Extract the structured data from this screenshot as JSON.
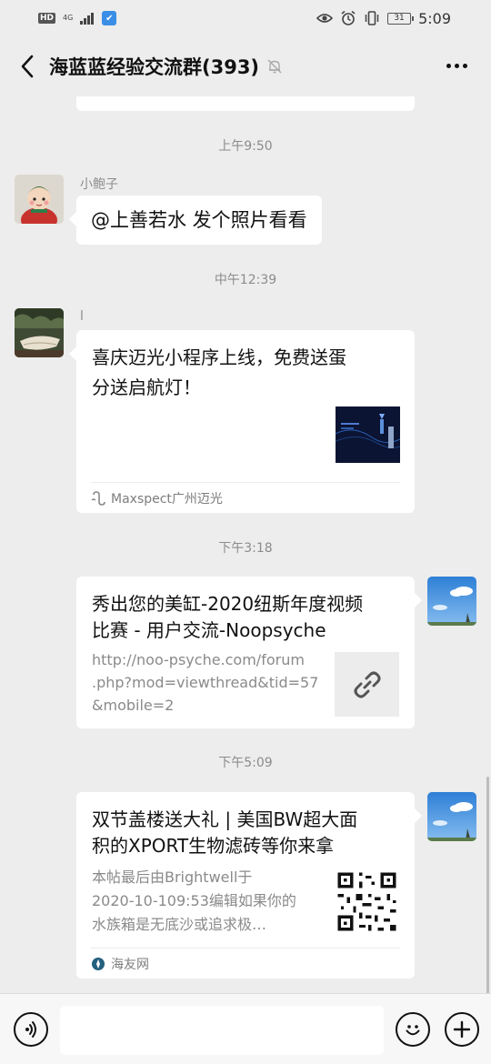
{
  "status_bar": {
    "hd": "HD",
    "network": "4G",
    "battery": "31",
    "time": "5:09"
  },
  "header": {
    "title": "海蓝蓝经验交流群(393)"
  },
  "messages": [
    {
      "type": "timestamp",
      "text": "上午9:50"
    },
    {
      "type": "text",
      "direction": "in",
      "sender": "小鲍子",
      "text": "@上善若水  发个照片看看"
    },
    {
      "type": "timestamp",
      "text": "中午12:39"
    },
    {
      "type": "card",
      "direction": "in",
      "sender": "l",
      "title_lines": [
        "喜庆迈光小程序上线，免费送蛋",
        "分送启航灯！"
      ],
      "source": "Maxspect广州迈光"
    },
    {
      "type": "timestamp",
      "text": "下午3:18"
    },
    {
      "type": "link",
      "direction": "out",
      "title_lines": [
        "秀出您的美缸-2020纽斯年度视频",
        "比赛 - 用户交流-Noopsyche"
      ],
      "desc_lines": [
        "http://noo-psyche.com/forum",
        ".php?mod=viewthread&tid=57",
        "&mobile=2"
      ]
    },
    {
      "type": "timestamp",
      "text": "下午5:09"
    },
    {
      "type": "card",
      "direction": "out",
      "title_lines": [
        "双节盖楼送大礼 | 美国BW超大面",
        "积的XPORT生物滤砖等你来拿"
      ],
      "desc_lines": [
        "本帖最后由Brightwell于",
        "2020-10-109:53编辑如果你的",
        "水族箱是无底沙或追求极…"
      ],
      "source": "海友网"
    }
  ],
  "input": {
    "placeholder": ""
  },
  "icons": {
    "back": "chevron-left-icon",
    "mute": "bell-off-icon",
    "more": "more-dots-icon",
    "voice": "voice-icon",
    "emoji": "emoji-icon",
    "plus": "plus-icon",
    "link": "link-icon"
  },
  "colors": {
    "background": "#ededed",
    "bubble": "#ffffff",
    "meta_text": "#8c8c8c",
    "input_bar": "#f7f7f7"
  }
}
